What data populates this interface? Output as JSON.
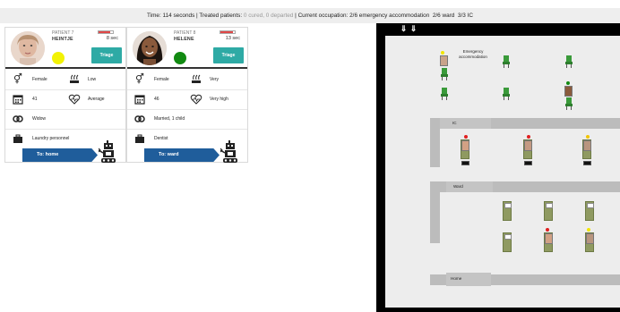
{
  "status_bar": {
    "time": "Time: 114 seconds",
    "treated_label": "Treated patients:",
    "treated_detail": "0 cured, 0 departed",
    "occupation_label": "Current occupation: 2/6 emergency accommodation",
    "ward": "2/6 ward",
    "ic": "3/3 IC"
  },
  "patients": [
    {
      "id_label": "PATIENT 7",
      "name": "HEINTJE",
      "timer": "8 sec",
      "timer_fraction": 0.8,
      "triage_color": "#f2f205",
      "triage_button": "Triage",
      "sex": "Female",
      "smoking": "Low",
      "age": "41",
      "heart": "Average",
      "relationship": "Widow",
      "job": "Laundry personnel",
      "destination": "To: home"
    },
    {
      "id_label": "PATIENT 8",
      "name": "HELENE",
      "timer": "13 sec",
      "timer_fraction": 0.9,
      "triage_color": "#128a12",
      "triage_button": "Triage",
      "sex": "Female",
      "smoking": "Very",
      "age": "46",
      "heart": "Very high",
      "relationship": "Married, 1 child",
      "job": "Dentist",
      "destination": "To: ward"
    }
  ],
  "map": {
    "emergency_label_line1": "Emergency",
    "emergency_label_line2": "accommodation",
    "ic_label": "IC",
    "ward_label": "Ward",
    "home_label": "Home"
  },
  "icons": {
    "sex": "gender-icon",
    "smoking": "smoking-icon",
    "age": "calendar-icon",
    "heart": "heart-icon",
    "relationship": "rings-icon",
    "job": "briefcase-icon",
    "robot": "robot-icon",
    "arrows": "down-arrow-icon"
  },
  "colors": {
    "triage_button": "#2eaaa5",
    "destination": "#1f5d9b",
    "chair": "#3a9a3a",
    "bed": "#8f9a61"
  }
}
